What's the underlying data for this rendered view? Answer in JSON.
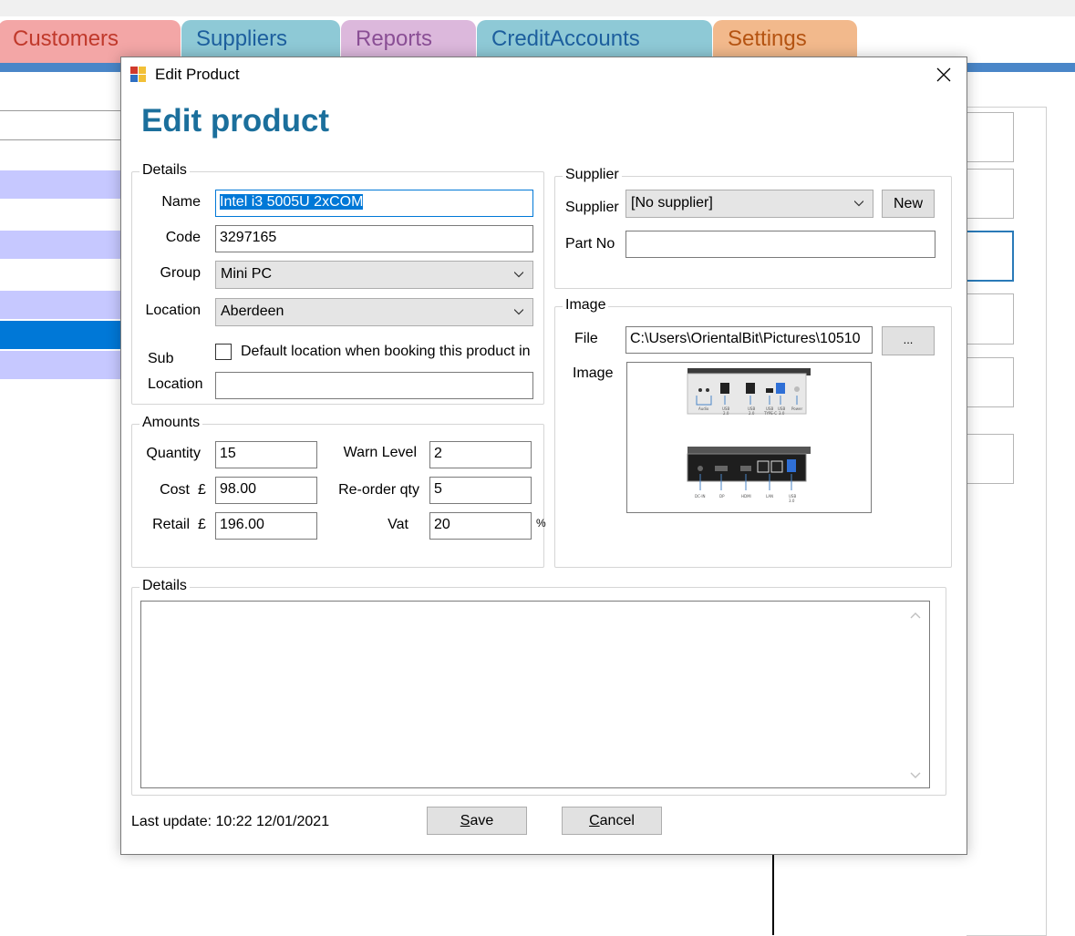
{
  "main": {
    "tabs": [
      {
        "label": "Customers",
        "bg": "#f3a6a6",
        "fg": "#c0392b"
      },
      {
        "label": "Suppliers",
        "bg": "#8ec9d6",
        "fg": "#1d5f9e"
      },
      {
        "label": "Reports",
        "bg": "#dcb8dc",
        "fg": "#8a4f95"
      },
      {
        "label": "CreditAccounts",
        "bg": "#8ec9d6",
        "fg": "#1d5f9e"
      },
      {
        "label": "Settings",
        "bg": "#f2b98c",
        "fg": "#b55412"
      }
    ]
  },
  "dialog": {
    "title": "Edit Product",
    "heading": "Edit product",
    "close_icon": "close-icon",
    "details": {
      "group_title": "Details",
      "name_label": "Name",
      "name_value": "Intel i3 5005U 2xCOM",
      "code_label": "Code",
      "code_value": "3297165",
      "group_label": "Group",
      "group_value": "Mini PC",
      "location_label": "Location",
      "location_value": "Aberdeen",
      "default_location_text": "Default location when booking this product in",
      "sub_label": "Sub",
      "sub_location_label": "Location",
      "sub_location_value": ""
    },
    "amounts": {
      "group_title": "Amounts",
      "quantity_label": "Quantity",
      "quantity_value": "15",
      "cost_label": "Cost",
      "currency": "£",
      "cost_value": "98.00",
      "retail_label": "Retail",
      "retail_value": "196.00",
      "warn_label": "Warn Level",
      "warn_value": "2",
      "reorder_label": "Re-order qty",
      "reorder_value": "5",
      "vat_label": "Vat",
      "vat_value": "20",
      "percent": "%"
    },
    "supplier": {
      "group_title": "Supplier",
      "supplier_label": "Supplier",
      "supplier_value": "[No supplier]",
      "new_button": "New",
      "partno_label": "Part No",
      "partno_value": ""
    },
    "image": {
      "group_title": "Image",
      "file_label": "File",
      "file_value": "C:\\Users\\OrientalBit\\Pictures\\10510",
      "browse_button": "...",
      "image_label": "Image",
      "port_labels_top": [
        "Audio",
        "USB",
        "USB",
        "USB",
        "USB",
        "Power"
      ],
      "port_sub_top": [
        "",
        "2.0",
        "2.0",
        "TYPE-C",
        "3.0",
        ""
      ],
      "port_labels_bottom": [
        "DC-IN",
        "DP",
        "HDMI",
        "LAN",
        "USB"
      ],
      "port_sub_bottom": [
        "",
        "",
        "",
        "",
        "3.0"
      ]
    },
    "notes": {
      "group_title": "Details",
      "value": ""
    },
    "footer": {
      "last_update_label": "Last update:",
      "last_update_value": "10:22 12/01/2021",
      "save_mnemonic": "S",
      "save_rest": "ave",
      "cancel_mnemonic": "C",
      "cancel_rest": "ancel"
    }
  }
}
